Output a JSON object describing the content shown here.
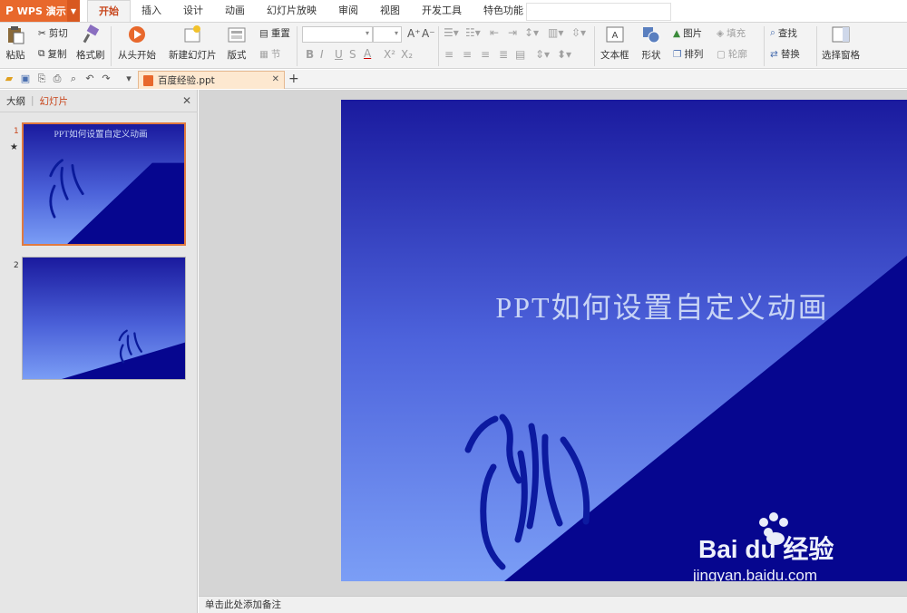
{
  "app": {
    "logo": "P",
    "title": "WPS 演示"
  },
  "tabs": [
    "开始",
    "插入",
    "设计",
    "动画",
    "幻灯片放映",
    "审阅",
    "视图",
    "开发工具",
    "特色功能"
  ],
  "active_tab": "开始",
  "ribbon": {
    "paste": "粘贴",
    "cut": "剪切",
    "copy": "复制",
    "format_painter": "格式刷",
    "from_start": "从头开始",
    "new_slide": "新建幻灯片",
    "layout": "版式",
    "reset": "重置",
    "section": "节",
    "bold": "B",
    "italic": "I",
    "underline": "U",
    "strike": "S",
    "font_color": "A",
    "superscript": "X²",
    "subscript": "X₂",
    "grow_font": "A⁺",
    "shrink_font": "A⁻",
    "textbox": "文本框",
    "shape": "形状",
    "picture": "图片",
    "arrange": "排列",
    "fill": "填充",
    "outline": "轮廓",
    "find": "查找",
    "replace": "替换",
    "select_pane": "选择窗格"
  },
  "document": {
    "tab_name": "百度经验.ppt",
    "new_tab": "+"
  },
  "panel": {
    "outline_tab": "大纲",
    "slides_tab": "幻灯片"
  },
  "slides": [
    {
      "number": "1",
      "has_animation": true,
      "title": "PPT如何设置自定义动画"
    },
    {
      "number": "2",
      "has_animation": false,
      "title": ""
    }
  ],
  "main_slide": {
    "title": "PPT如何设置自定义动画"
  },
  "notes": {
    "placeholder": "单击此处添加备注"
  },
  "watermark": {
    "brand": "Bai du 经验",
    "url": "jingyan.baidu.com"
  },
  "colors": {
    "accent": "#e8682c",
    "slide_top": "#1a1a9e",
    "slide_bottom": "#7a9df5",
    "slide_dark": "#06068f"
  }
}
